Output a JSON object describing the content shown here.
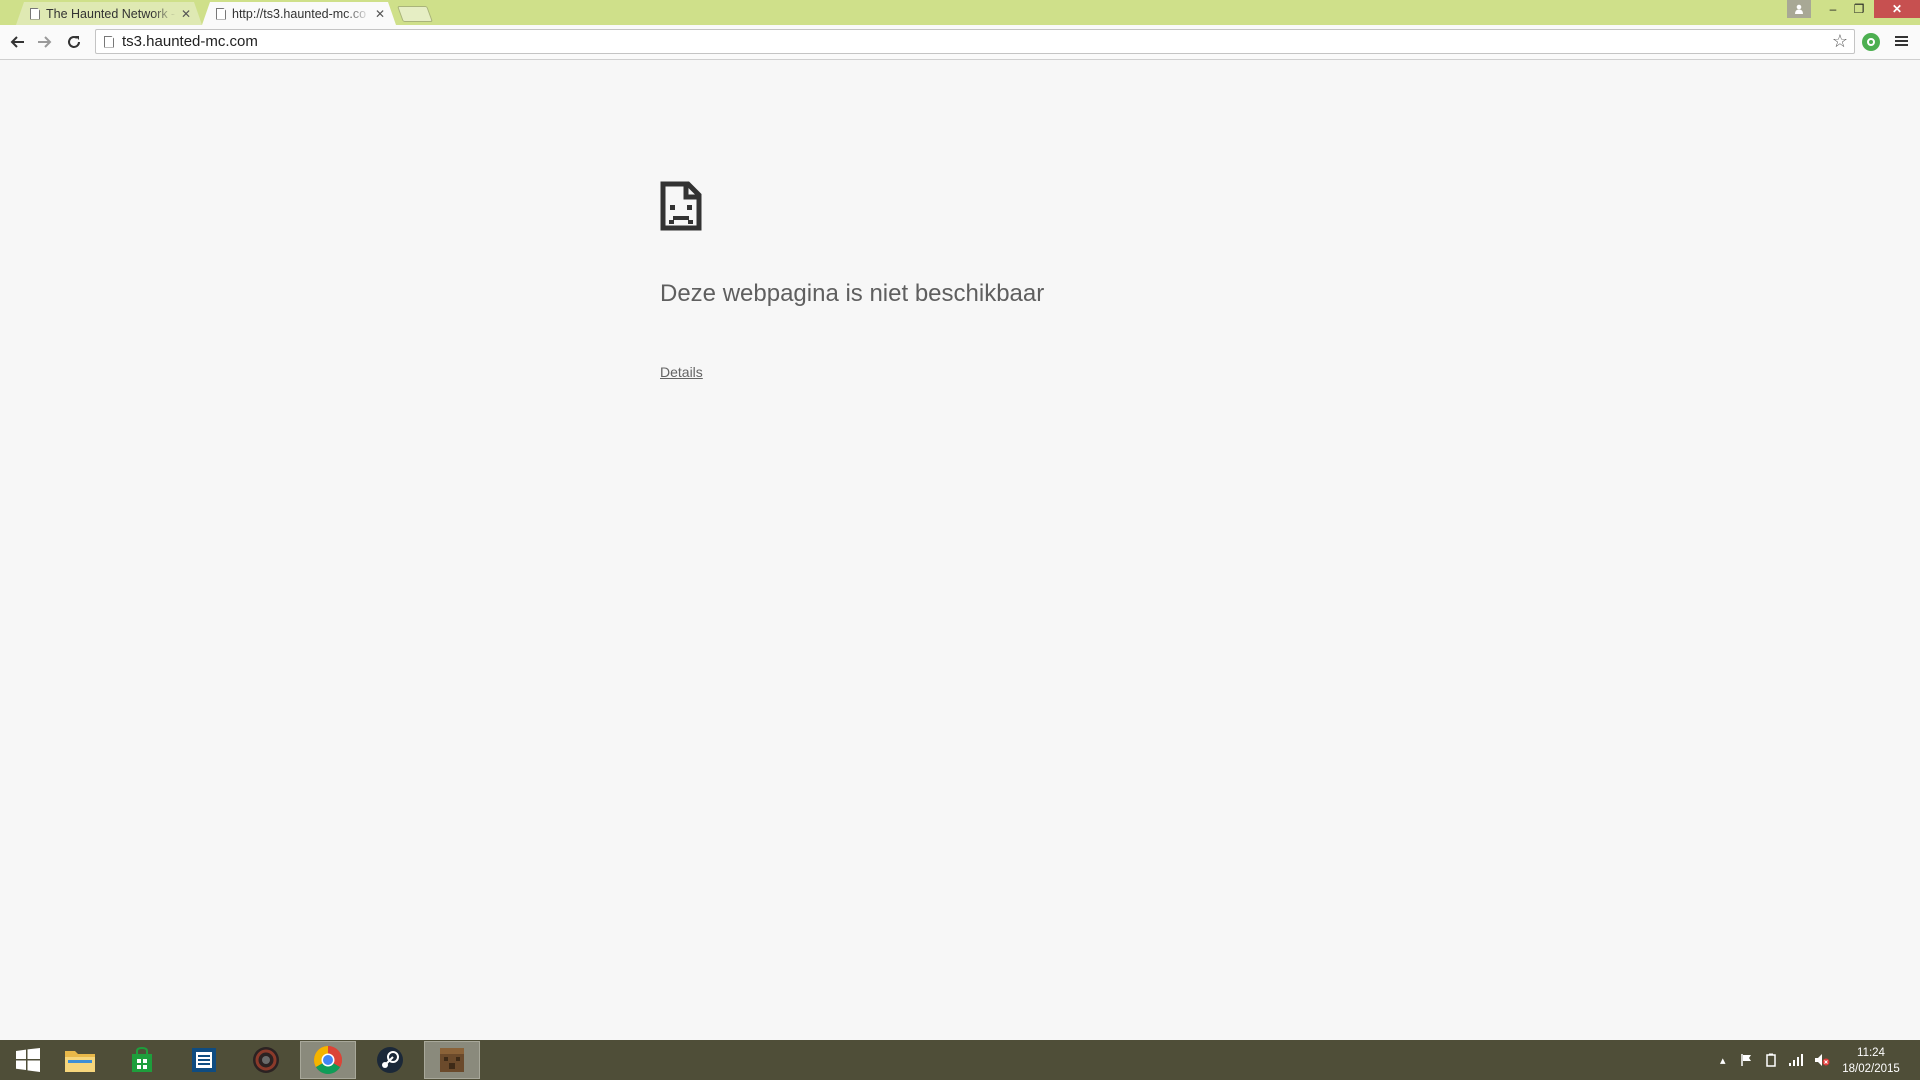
{
  "browser": {
    "tabs": [
      {
        "title": "The Haunted Network - p",
        "active": false
      },
      {
        "title": "http://ts3.haunted-mc.co",
        "active": true
      }
    ],
    "omnibox": {
      "url": "ts3.haunted-mc.com"
    },
    "colors": {
      "frame": "#cfe08a",
      "close": "#c75050"
    },
    "window_buttons": {
      "minimize": "–",
      "maximize": "❐",
      "close": "✕"
    }
  },
  "error_page": {
    "heading": "Deze webpagina is niet beschikbaar",
    "details_link": "Details"
  },
  "taskbar": {
    "apps": [
      "start-icon",
      "file-explorer-icon",
      "store-icon",
      "news-app-icon",
      "obs-icon",
      "chrome-icon",
      "steam-icon",
      "minecraft-icon"
    ],
    "clock": {
      "time": "11:24",
      "date": "18/02/2015"
    }
  }
}
